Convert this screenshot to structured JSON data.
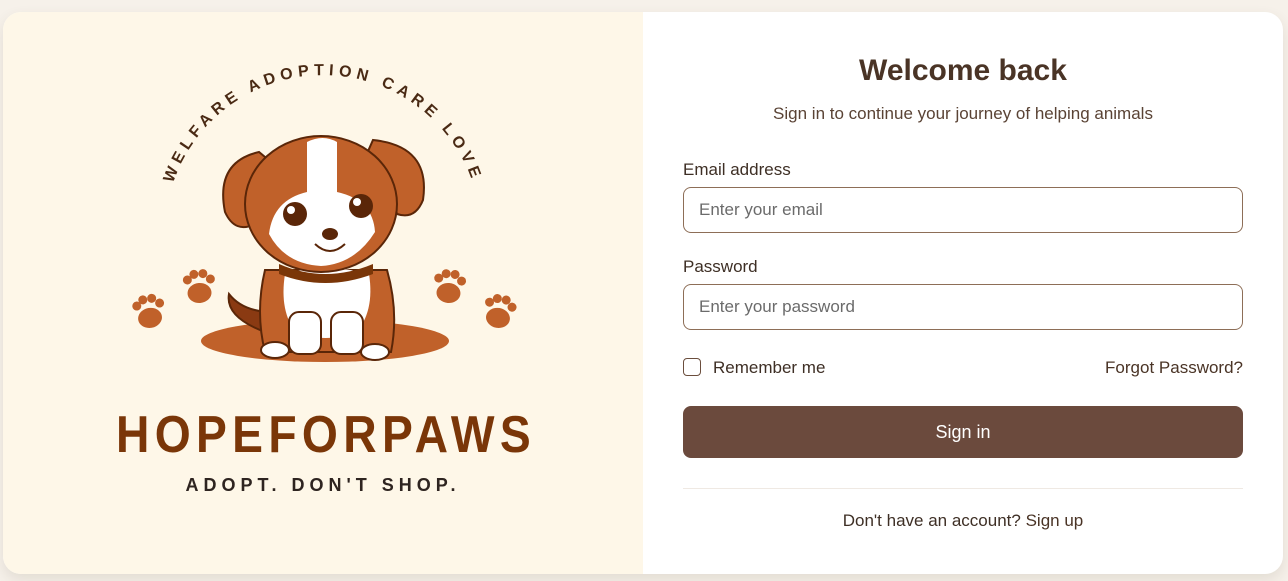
{
  "brand": {
    "arc_text": "WELFARE ADOPTION CARE LOVE",
    "name": "HOPEFORPAWS",
    "tagline": "ADOPT. DON'T SHOP."
  },
  "login": {
    "title": "Welcome back",
    "subtitle": "Sign in to continue your journey of helping animals",
    "email_label": "Email address",
    "email_placeholder": "Enter your email",
    "email_value": "",
    "password_label": "Password",
    "password_placeholder": "Enter your password",
    "password_value": "",
    "remember_label": "Remember me",
    "remember_checked": false,
    "forgot_label": "Forgot Password?",
    "signin_label": "Sign in",
    "signup_prompt": "Don't have an account?",
    "signup_label": "Sign up"
  },
  "colors": {
    "page_bg": "#f6f1ea",
    "left_panel_bg": "#fef7e8",
    "brand_brown": "#7a3608",
    "dog_orange": "#c0612a",
    "button_bg": "#6b4a3d",
    "heading_text": "#4a3426"
  },
  "icons": [
    "dog-logo-icon",
    "paw-icon",
    "checkbox-icon"
  ]
}
